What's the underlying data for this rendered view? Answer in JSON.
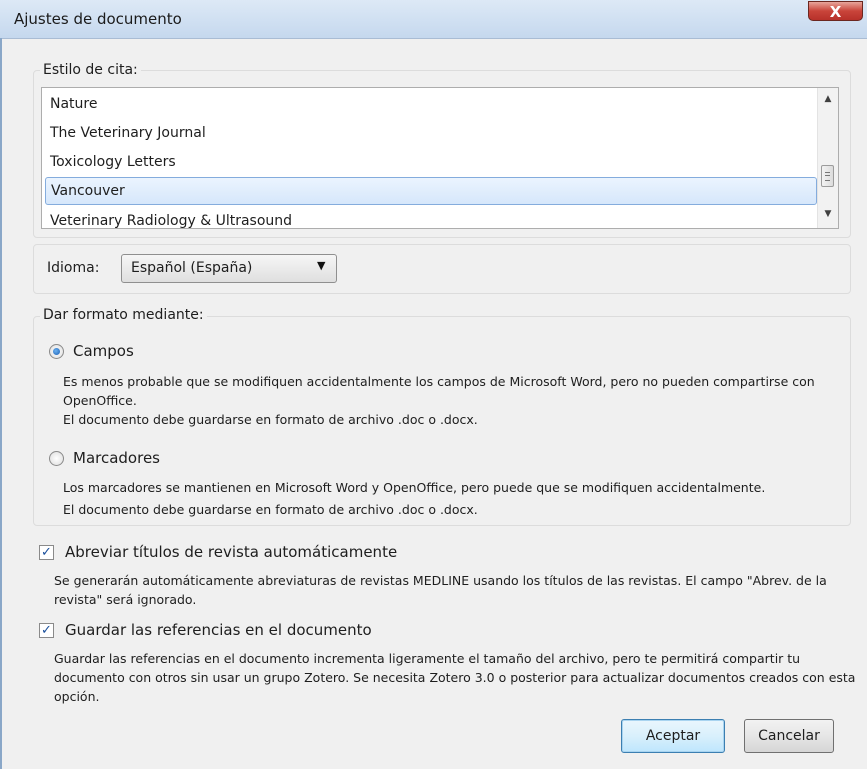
{
  "window": {
    "title": "Ajustes de documento",
    "close_glyph": "X",
    "close_icon": "close-icon"
  },
  "citation_style": {
    "legend": "Estilo de cita:",
    "items": [
      {
        "label": "Nature"
      },
      {
        "label": "The Veterinary Journal"
      },
      {
        "label": "Toxicology Letters"
      },
      {
        "label": "Vancouver"
      },
      {
        "label": "Veterinary Radiology & Ultrasound"
      }
    ],
    "selected": "Vancouver"
  },
  "language": {
    "label": "Idioma:",
    "value": "Español (España)"
  },
  "format_using": {
    "legend": "Dar formato mediante:",
    "fields": {
      "label": "Campos",
      "checked": true,
      "desc1": "Es menos probable que se modifiquen accidentalmente los campos de Microsoft Word, pero no pueden compartirse con OpenOffice.",
      "desc2": "El documento debe guardarse en formato de archivo .doc o .docx."
    },
    "bookmarks": {
      "label": "Marcadores",
      "checked": false,
      "desc1": "Los marcadores se mantienen en Microsoft Word y OpenOffice, pero puede que se modifiquen accidentalmente.",
      "desc2": "El documento debe guardarse en formato de archivo .doc o .docx."
    }
  },
  "abbreviate": {
    "label": "Abreviar títulos de revista automáticamente",
    "checked": true,
    "desc": "Se generarán automáticamente abreviaturas de revistas MEDLINE usando los títulos de las revistas. El campo \"Abrev. de la revista\" será ignorado."
  },
  "store_references": {
    "label": "Guardar las referencias en el documento",
    "checked": true,
    "desc": "Guardar las referencias en el documento incrementa ligeramente el tamaño del archivo, pero te permitirá compartir tu documento con otros sin usar un grupo Zotero. Se necesita Zotero 3.0 o posterior para actualizar documentos creados con esta opción."
  },
  "buttons": {
    "ok": "Aceptar",
    "cancel": "Cancelar"
  },
  "colors": {
    "selection_border": "#84acdd",
    "check_mark": "#1a4f9c",
    "close_red": "#c9443a"
  }
}
